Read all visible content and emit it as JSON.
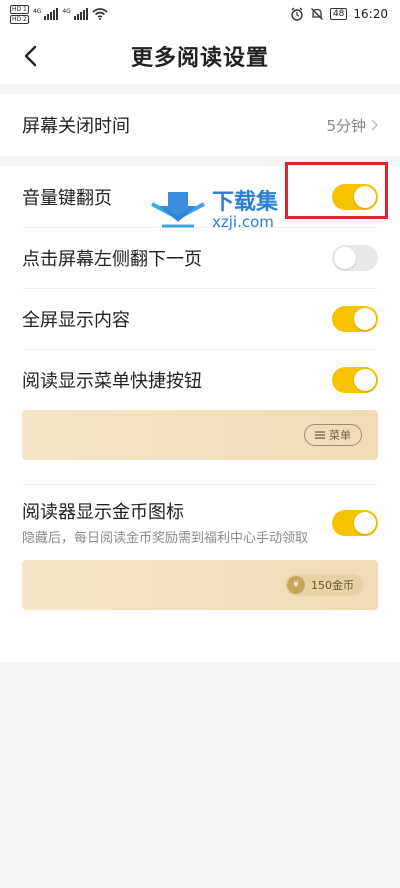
{
  "status_bar": {
    "hd1": "HD 1",
    "hd2": "HD 2",
    "net1": "4G",
    "net2": "4G",
    "battery": "48",
    "time": "16:20"
  },
  "header": {
    "title": "更多阅读设置"
  },
  "screen_off": {
    "label": "屏幕关闭时间",
    "value": "5分钟"
  },
  "settings": {
    "volume_page": {
      "label": "音量键翻页",
      "on": true
    },
    "tap_left": {
      "label": "点击屏幕左侧翻下一页",
      "on": false
    },
    "fullscreen": {
      "label": "全屏显示内容",
      "on": true
    },
    "menu_shortcut": {
      "label": "阅读显示菜单快捷按钮",
      "on": true,
      "preview_chip": "菜单"
    },
    "coin_icon": {
      "label": "阅读器显示金币图标",
      "description": "隐藏后，每日阅读金币奖励需到福利中心手动领取",
      "on": true,
      "preview_chip": "150金币",
      "coin_symbol": "¥"
    }
  },
  "watermark": {
    "cn": "下载集",
    "en": "xzji.com"
  },
  "colors": {
    "accent": "#f7c200",
    "highlight": "#d8262a",
    "watermark": "#2a7fd8"
  }
}
